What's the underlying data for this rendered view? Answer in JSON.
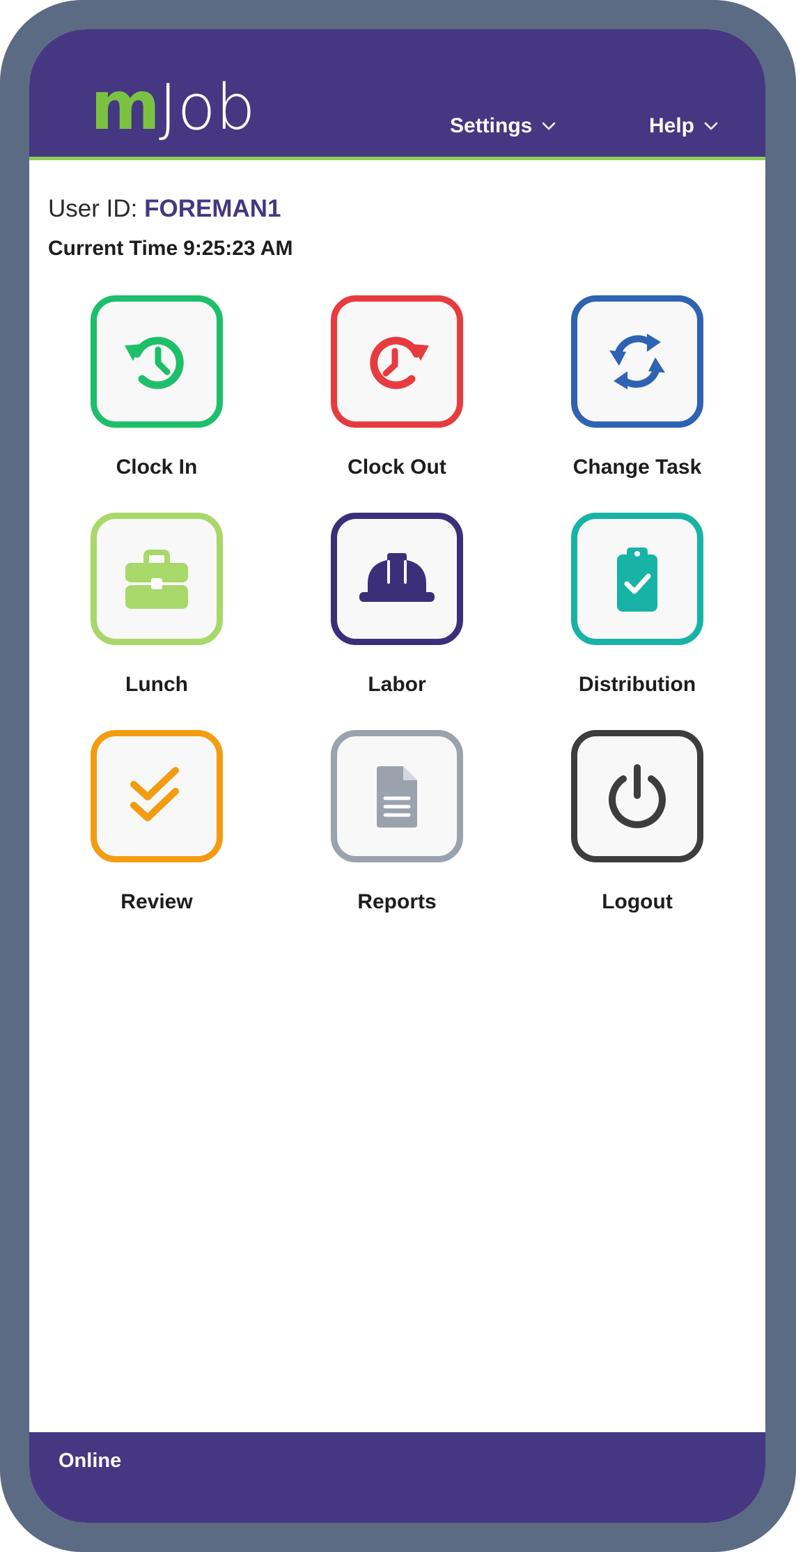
{
  "header": {
    "logo_m": "m",
    "logo_job": "Job",
    "settings_label": "Settings",
    "help_label": "Help",
    "colors": {
      "bar": "#453782",
      "accent": "#8fce5b"
    }
  },
  "user": {
    "id_label": "User ID:",
    "id_value": "FOREMAN1",
    "time_label": "Current Time",
    "time_value": "9:25:23 AM"
  },
  "tiles": [
    {
      "label": "Clock In",
      "icon": "clock-in-icon",
      "color": "#1dbf6a"
    },
    {
      "label": "Clock Out",
      "icon": "clock-out-icon",
      "color": "#e83b3f"
    },
    {
      "label": "Change Task",
      "icon": "change-task-icon",
      "color": "#2e63b3"
    },
    {
      "label": "Lunch",
      "icon": "briefcase-icon",
      "color": "#a8d869"
    },
    {
      "label": "Labor",
      "icon": "hard-hat-icon",
      "color": "#3c2f7a"
    },
    {
      "label": "Distribution",
      "icon": "clipboard-check-icon",
      "color": "#17b3a6"
    },
    {
      "label": "Review",
      "icon": "double-check-icon",
      "color": "#f39c12"
    },
    {
      "label": "Reports",
      "icon": "document-icon",
      "color": "#9aa2ad"
    },
    {
      "label": "Logout",
      "icon": "power-icon",
      "color": "#3d3d3d"
    }
  ],
  "footer": {
    "status": "Online"
  }
}
